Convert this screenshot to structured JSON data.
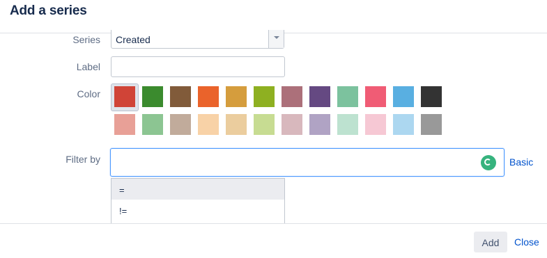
{
  "dialog": {
    "title": "Add a series"
  },
  "form": {
    "series": {
      "label": "Series",
      "value": "Created"
    },
    "label_field": {
      "label": "Label",
      "value": ""
    },
    "color": {
      "label": "Color",
      "selected": "#d04437",
      "swatches_row1": [
        "#d04437",
        "#3b8b2e",
        "#815b3a",
        "#ea632b",
        "#d59d3d",
        "#8eb021",
        "#ac707a",
        "#654982",
        "#7cc29e",
        "#f05c75",
        "#59afe1",
        "#333333"
      ],
      "swatches_row2": [
        "#e8a097",
        "#8cc592",
        "#c1ab9b",
        "#f8d2a7",
        "#ebcd9e",
        "#c7dc92",
        "#d8b8bd",
        "#b0a3c4",
        "#bde2d0",
        "#f6c8d4",
        "#acd7f0",
        "#999999"
      ]
    },
    "filter": {
      "label": "Filter by",
      "value": "",
      "mode_link": "Basic"
    }
  },
  "dropdown": {
    "items": [
      "=",
      "!="
    ],
    "active_index": 0
  },
  "footer": {
    "add_label": "Add",
    "close_label": "Close"
  }
}
